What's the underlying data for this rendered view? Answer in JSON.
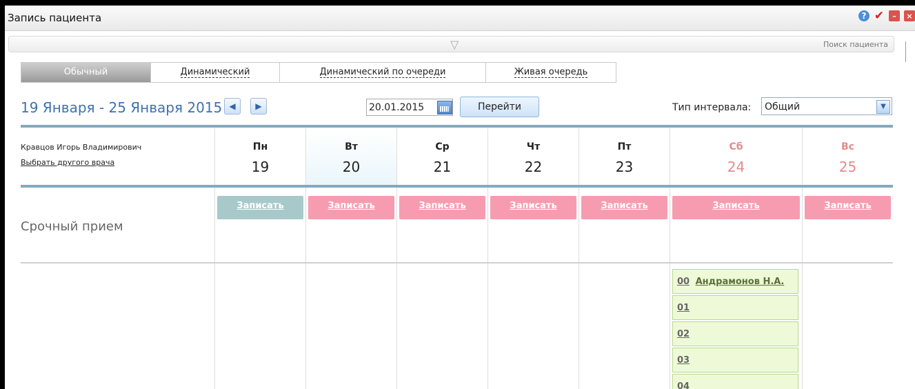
{
  "window": {
    "title": "Запись пациента"
  },
  "search": {
    "label": "Поиск пациента"
  },
  "tabs": [
    {
      "label": "Обычный"
    },
    {
      "label": "Динамический"
    },
    {
      "label": "Динамический по очереди"
    },
    {
      "label": "Живая очередь"
    }
  ],
  "range": {
    "text": "19 Января - 25 Января 2015"
  },
  "date": {
    "value": "20.01.2015"
  },
  "go": {
    "label": "Перейти"
  },
  "interval": {
    "label": "Тип интервала:",
    "value": "Общий"
  },
  "doctor": {
    "name": "Кравцов Игорь Владимирович",
    "change_link": "Выбрать другого врача"
  },
  "days": [
    {
      "name": "Пн",
      "num": "19"
    },
    {
      "name": "Вт",
      "num": "20"
    },
    {
      "name": "Ср",
      "num": "21"
    },
    {
      "name": "Чт",
      "num": "22"
    },
    {
      "name": "Пт",
      "num": "23"
    },
    {
      "name": "Сб",
      "num": "24"
    },
    {
      "name": "Вс",
      "num": "25"
    }
  ],
  "record_label": "Записать",
  "urgent": {
    "label": "Срочный прием"
  },
  "slots": [
    {
      "time": "00",
      "patient": "Андрамонов Н.А."
    },
    {
      "time": "01",
      "patient": ""
    },
    {
      "time": "02",
      "patient": ""
    },
    {
      "time": "03",
      "patient": ""
    },
    {
      "time": "04",
      "patient": ""
    }
  ],
  "colors": {
    "accent": "#3c73b0",
    "record": "#f79cb0",
    "record_past": "#a8c9c9",
    "slot": "#eefad7",
    "weekend": "#e48b8b"
  }
}
